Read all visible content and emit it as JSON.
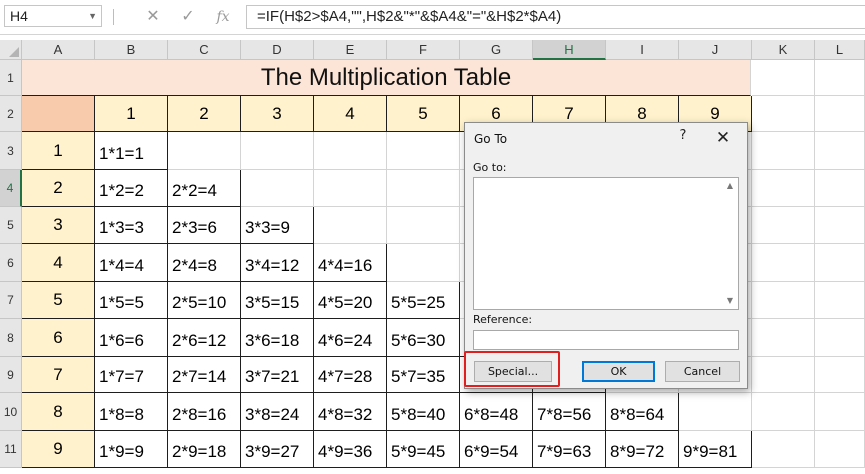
{
  "formula_bar": {
    "name_box": "H4",
    "name_box_dropdown_icon": "chevron-down-icon",
    "cancel_icon": "✕",
    "enter_icon": "✓",
    "fx_label": "fx",
    "formula": "=IF(H$2>$A4,\"\",H$2&\"*\"&$A4&\"=\"&H$2*$A4)"
  },
  "columns": [
    "A",
    "B",
    "C",
    "D",
    "E",
    "F",
    "G",
    "H",
    "I",
    "J",
    "K",
    "L"
  ],
  "selected_column": "H",
  "rows": [
    "1",
    "2",
    "3",
    "4",
    "5",
    "6",
    "7",
    "8",
    "9",
    "10",
    "11"
  ],
  "selected_row": "4",
  "sheet": {
    "title": "The Multiplication Table",
    "header_numbers": [
      "1",
      "2",
      "3",
      "4",
      "5",
      "6",
      "7",
      "8",
      "9"
    ],
    "row_numbers": [
      "1",
      "2",
      "3",
      "4",
      "5",
      "6",
      "7",
      "8",
      "9"
    ],
    "products": [
      [
        "1*1=1",
        "",
        "",
        "",
        "",
        "",
        "",
        "",
        ""
      ],
      [
        "1*2=2",
        "2*2=4",
        "",
        "",
        "",
        "",
        "",
        "",
        ""
      ],
      [
        "1*3=3",
        "2*3=6",
        "3*3=9",
        "",
        "",
        "",
        "",
        "",
        ""
      ],
      [
        "1*4=4",
        "2*4=8",
        "3*4=12",
        "4*4=16",
        "",
        "",
        "",
        "",
        ""
      ],
      [
        "1*5=5",
        "2*5=10",
        "3*5=15",
        "4*5=20",
        "5*5=25",
        "",
        "",
        "",
        ""
      ],
      [
        "1*6=6",
        "2*6=12",
        "3*6=18",
        "4*6=24",
        "5*6=30",
        "",
        "",
        "",
        ""
      ],
      [
        "1*7=7",
        "2*7=14",
        "3*7=21",
        "4*7=28",
        "5*7=35",
        "",
        "",
        "",
        ""
      ],
      [
        "1*8=8",
        "2*8=16",
        "3*8=24",
        "4*8=32",
        "5*8=40",
        "6*8=48",
        "7*8=56",
        "8*8=64",
        ""
      ],
      [
        "1*9=9",
        "2*9=18",
        "3*9=27",
        "4*9=36",
        "5*9=45",
        "6*9=54",
        "7*9=63",
        "8*9=72",
        "9*9=81"
      ]
    ]
  },
  "dialog": {
    "title": "Go To",
    "help": "?",
    "close": "✕",
    "goto_label": "Go to:",
    "reference_label": "Reference:",
    "reference_value": "",
    "special_button": "Special...",
    "ok_button": "OK",
    "cancel_button": "Cancel"
  },
  "colors": {
    "title_fill": "#fce4d6",
    "header_fill": "#fff2cc",
    "corner_fill": "#f8cbad",
    "highlight_box": "#e02020",
    "excel_green": "#217346"
  }
}
